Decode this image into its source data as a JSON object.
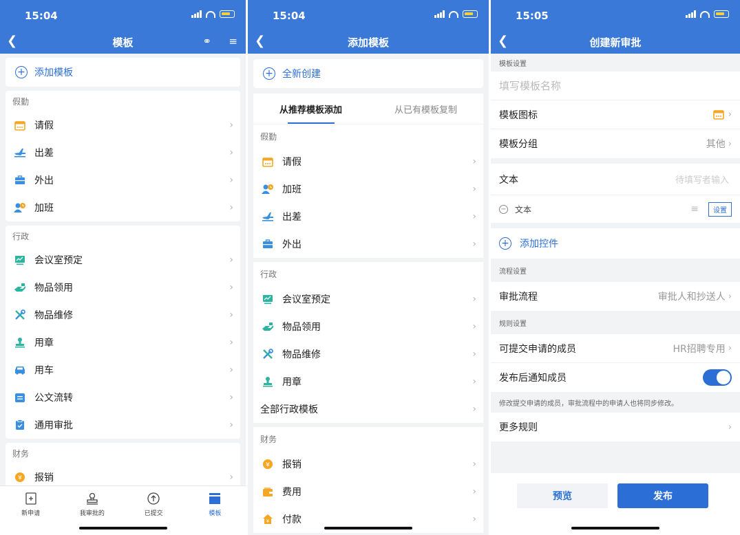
{
  "colors": {
    "primary": "#3a79d8",
    "accent": "#2b6fd6",
    "background": "#f2f3f5",
    "orange": "#f5a623",
    "green": "#2bb5a0"
  },
  "screen1": {
    "time": "15:04",
    "title": "模板",
    "add_label": "添加模板",
    "sections": [
      {
        "title": "假勤",
        "items": [
          {
            "label": "请假",
            "icon": "calendar-icon"
          },
          {
            "label": "出差",
            "icon": "airplane-icon"
          },
          {
            "label": "外出",
            "icon": "briefcase-icon"
          },
          {
            "label": "加班",
            "icon": "overtime-person-icon"
          }
        ]
      },
      {
        "title": "行政",
        "items": [
          {
            "label": "会议室预定",
            "icon": "meeting-room-icon"
          },
          {
            "label": "物品领用",
            "icon": "hand-receive-icon"
          },
          {
            "label": "物品维修",
            "icon": "repair-tools-icon"
          },
          {
            "label": "用章",
            "icon": "stamp-icon"
          },
          {
            "label": "用车",
            "icon": "car-icon"
          },
          {
            "label": "公文流转",
            "icon": "document-flow-icon"
          },
          {
            "label": "通用审批",
            "icon": "clipboard-check-icon"
          }
        ]
      },
      {
        "title": "财务",
        "items": [
          {
            "label": "报销",
            "icon": "yen-coin-icon"
          }
        ]
      }
    ],
    "tabbar": [
      {
        "label": "新申请",
        "icon": "new-request-icon"
      },
      {
        "label": "我审批的",
        "icon": "stamp-icon"
      },
      {
        "label": "已提交",
        "icon": "upload-icon"
      },
      {
        "label": "模板",
        "icon": "template-icon"
      }
    ]
  },
  "screen2": {
    "time": "15:04",
    "title": "添加模板",
    "create_label": "全新创建",
    "tabs": [
      "从推荐模板添加",
      "从已有模板复制"
    ],
    "sections": [
      {
        "title": "假勤",
        "items": [
          {
            "label": "请假",
            "icon": "calendar-icon"
          },
          {
            "label": "加班",
            "icon": "overtime-person-icon"
          },
          {
            "label": "出差",
            "icon": "airplane-icon"
          },
          {
            "label": "外出",
            "icon": "briefcase-icon"
          }
        ]
      },
      {
        "title": "行政",
        "items": [
          {
            "label": "会议室预定",
            "icon": "meeting-room-icon"
          },
          {
            "label": "物品领用",
            "icon": "hand-receive-icon"
          },
          {
            "label": "物品维修",
            "icon": "repair-tools-icon"
          },
          {
            "label": "用章",
            "icon": "stamp-icon"
          },
          {
            "label": "全部行政模板",
            "icon": ""
          }
        ]
      },
      {
        "title": "财务",
        "items": [
          {
            "label": "报销",
            "icon": "yen-coin-icon"
          },
          {
            "label": "费用",
            "icon": "wallet-icon"
          },
          {
            "label": "付款",
            "icon": "payment-house-icon"
          }
        ]
      }
    ]
  },
  "screen3": {
    "time": "15:05",
    "title": "创建新审批",
    "template_settings": "模板设置",
    "name_placeholder": "填写模板名称",
    "icon_label": "模板图标",
    "group_label": "模板分组",
    "group_value": "其他",
    "text_label": "文本",
    "text_placeholder": "待填写者输入",
    "text_field_label": "文本",
    "settings_button": "设置",
    "add_control": "添加控件",
    "flow_settings": "流程设置",
    "flow_label": "审批流程",
    "flow_value": "审批人和抄送人",
    "rule_settings": "规则设置",
    "submitters_label": "可提交申请的成员",
    "submitters_value": "HR招聘专用",
    "notify_label": "发布后通知成员",
    "notify_on": true,
    "note": "修改提交申请的成员，审批流程中的申请人也将同步修改。",
    "more_rules": "更多规则",
    "preview_button": "预览",
    "publish_button": "发布"
  }
}
